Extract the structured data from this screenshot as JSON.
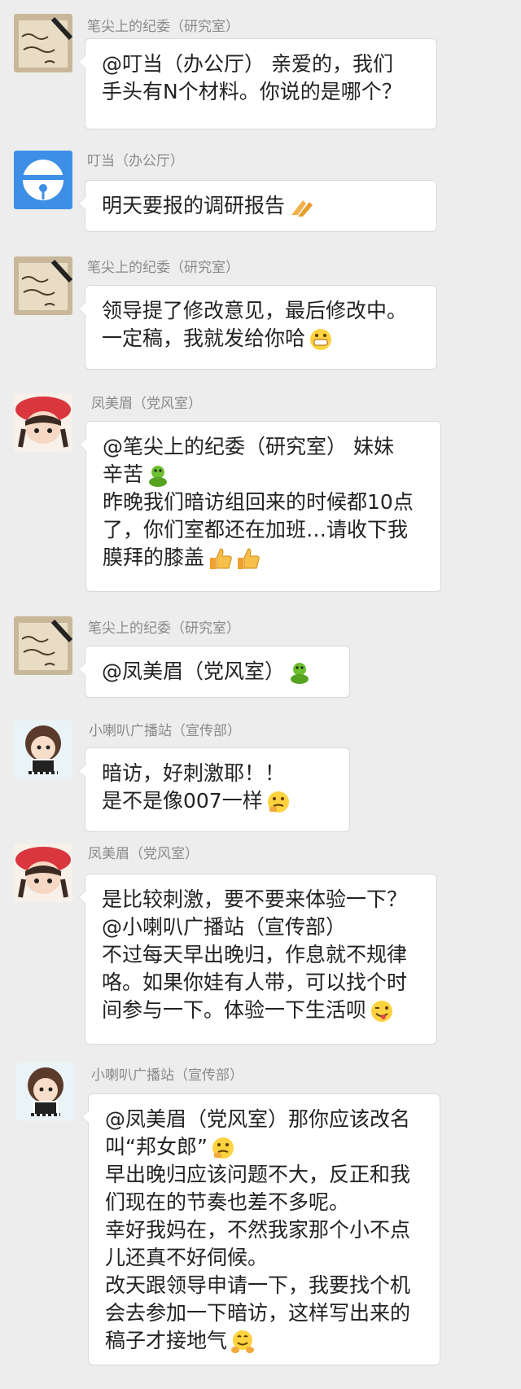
{
  "messages": [
    {
      "sender": "笔尖上的纪委（研究室）",
      "avatar": "avatar-bijian",
      "lines": [
        "@叮当（办公厅） 亲爱的，我们",
        "手头有N个材料。你说的是哪个？"
      ]
    },
    {
      "sender": "叮当（办公厅）",
      "avatar": "avatar-dingdang",
      "lines": [
        "明天要报的调研报告"
      ],
      "emoji": "clapping-hands-icon"
    },
    {
      "sender": "笔尖上的纪委（研究室）",
      "avatar": "avatar-bijian",
      "lines": [
        "领导提了修改意见，最后修改中。",
        "一定稿，我就发给你哈"
      ],
      "emoji": "grin-face-icon"
    },
    {
      "sender": "凤美眉（党风室）",
      "avatar": "avatar-fengmeimei",
      "lines": [
        "@笔尖上的纪委（研究室） 妹妹",
        "辛苦",
        "昨晚我们暗访组回来的时候都10点",
        "了，你们室都还在加班…请收下我",
        "膜拜的膝盖"
      ]
    },
    {
      "sender": "笔尖上的纪委（研究室）",
      "avatar": "avatar-bijian",
      "lines": [
        "@凤美眉（党风室）"
      ],
      "emoji": "frog-hug-icon"
    },
    {
      "sender": "小喇叭广播站（宣传部）",
      "avatar": "avatar-xiaolaba",
      "lines": [
        "暗访，好刺激耶！！",
        "是不是像007一样"
      ],
      "emoji": "thinking-face-icon"
    },
    {
      "sender": "凤美眉（党风室）",
      "avatar": "avatar-fengmeimei",
      "lines": [
        "是比较刺激，要不要来体验一下？",
        "@小喇叭广播站（宣传部）",
        "不过每天早出晚归，作息就不规律",
        "咯。如果你娃有人带，可以找个时",
        "间参与一下。体验一下生活呗"
      ],
      "emoji": "wink-tongue-icon"
    },
    {
      "sender": "小喇叭广播站（宣传部）",
      "avatar": "avatar-xiaolaba",
      "lines": [
        "@凤美眉（党风室）那你应该改名",
        "叫“邦女郎”",
        "早出晚归应该问题不大，反正和我",
        "们现在的节奏也差不多呢。",
        "幸好我妈在，不然我家那个小不点",
        "儿还真不好伺候。",
        "改天跟领导申请一下，我要找个机",
        "会去参加一下暗访，这样写出来的",
        "稿子才接地气"
      ]
    }
  ]
}
